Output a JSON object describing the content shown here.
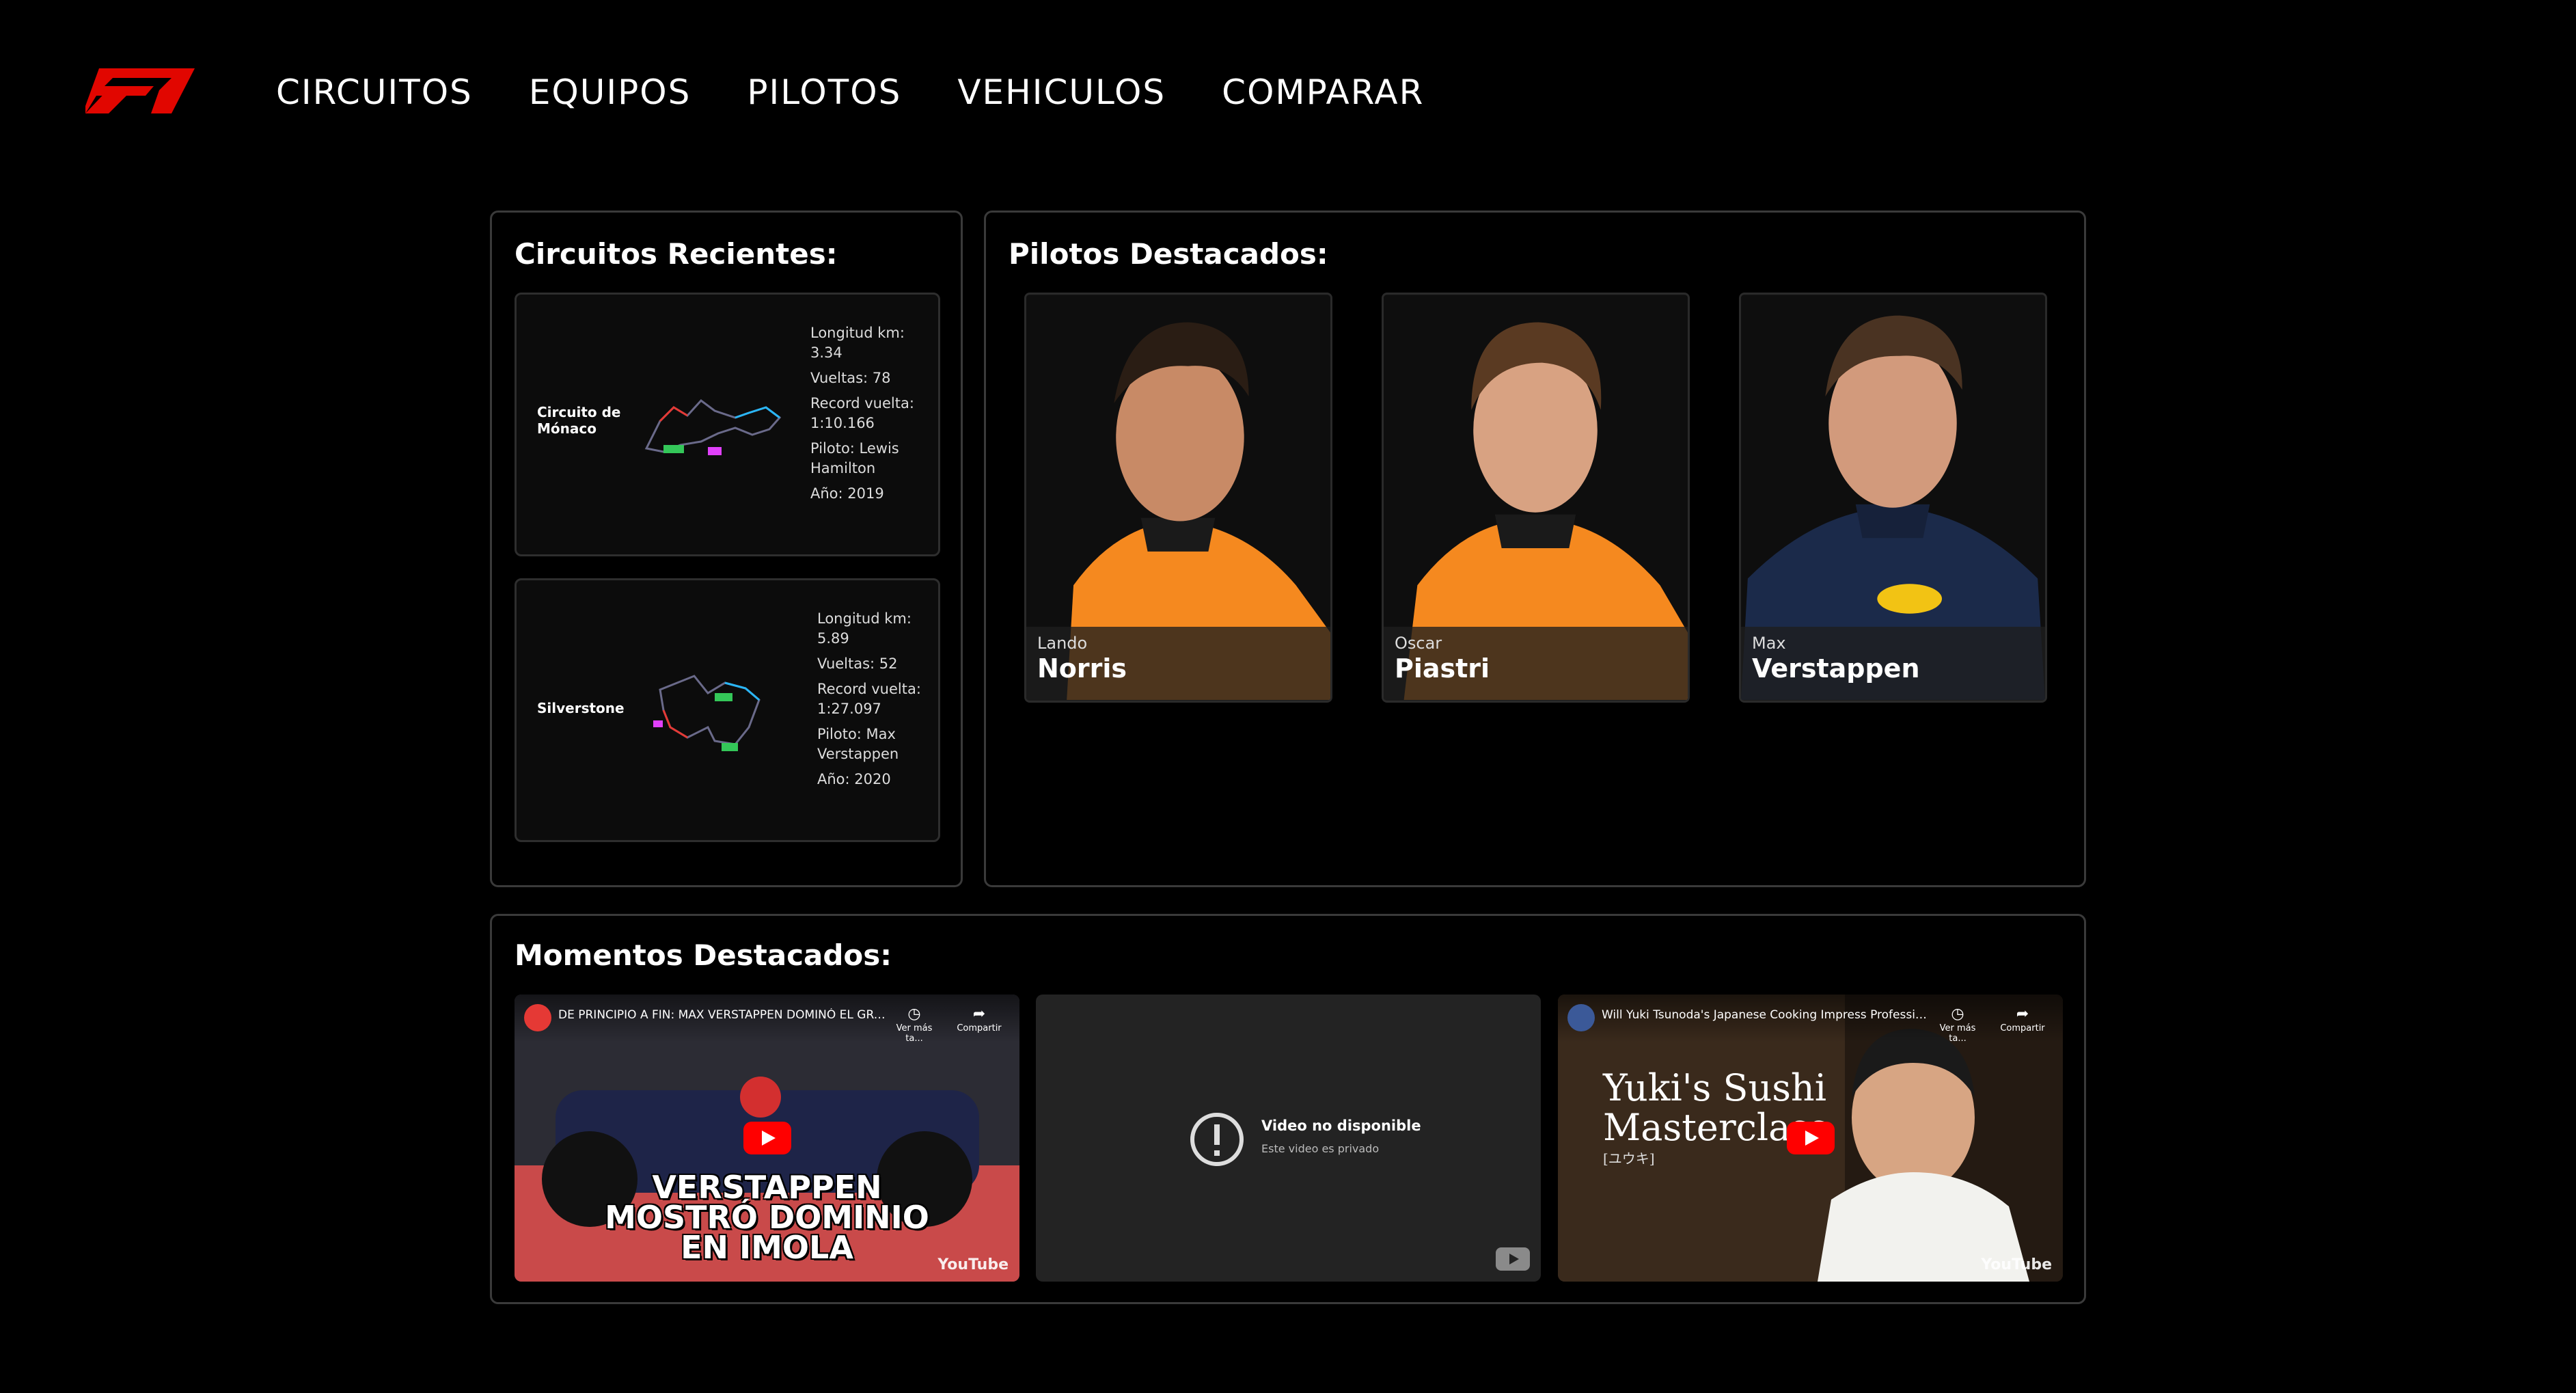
{
  "nav": {
    "logo_alt": "F1",
    "items": [
      "CIRCUITOS",
      "EQUIPOS",
      "PILOTOS",
      "VEHICULOS",
      "COMPARAR"
    ]
  },
  "colors": {
    "accent": "#e10600",
    "panel_border": "#3a3a3a",
    "track_start": "#34c759",
    "track_sector": "#e040fb"
  },
  "circuits_panel": {
    "title": "Circuitos Recientes:",
    "cards": [
      {
        "name": "Circuito de Mónaco",
        "length": "Longitud km: 3.34",
        "laps": "Vueltas: 78",
        "record": "Record vuelta: 1:10.166",
        "pilot": "Piloto: Lewis Hamilton",
        "year": "Año: 2019"
      },
      {
        "name": "Silverstone",
        "length": "Longitud km: 5.89",
        "laps": "Vueltas: 52",
        "record": "Record vuelta: 1:27.097",
        "pilot": "Piloto: Max Verstappen",
        "year": "Año: 2020"
      }
    ]
  },
  "pilots_panel": {
    "title": "Pilotos Destacados:",
    "pilots": [
      {
        "first": "Lando",
        "last": "Norris",
        "suit": "#f5891f",
        "bg": "#0e0e0e"
      },
      {
        "first": "Oscar",
        "last": "Piastri",
        "suit": "#f5891f",
        "bg": "#0e0e0e"
      },
      {
        "first": "Max",
        "last": "Verstappen",
        "suit": "#1b2a4a",
        "bg": "#0e0e0e"
      }
    ]
  },
  "moments_panel": {
    "title": "Momentos Destacados:",
    "videos": [
      {
        "title": "DE PRINCIPIO A FIN: MAX VERSTAPPEN DOMINÓ EL GRA...",
        "watch_later": "Ver más ta...",
        "share": "Compartir",
        "overlay": [
          "VERSTAPPEN",
          "MOSTRÓ DOMINIO",
          "EN IMOLA"
        ],
        "brand": "YouTube"
      },
      {
        "unavailable_title": "Video no disponible",
        "unavailable_sub": "Este video es privado"
      },
      {
        "title": "Will Yuki Tsunoda's Japanese Cooking Impress Profession...",
        "watch_later": "Ver más ta...",
        "share": "Compartir",
        "overlay_line1": "Yuki's Sushi",
        "overlay_line2": "Masterclass",
        "overlay_sub": "[ユウキ]",
        "brand": "YouTube"
      }
    ]
  }
}
